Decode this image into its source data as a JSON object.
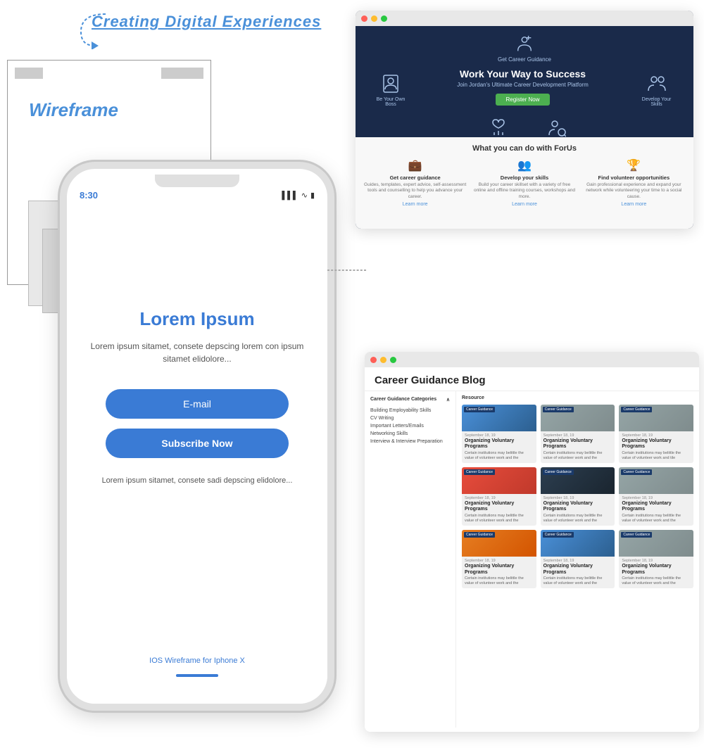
{
  "page": {
    "heading": "Creating Digital Experiences"
  },
  "wireframe": {
    "label": "Wireframe"
  },
  "iphone": {
    "status_time": "8:30",
    "lorem_title": "Lorem Ipsum",
    "lorem_desc": "Lorem ipsum sitamet, consete depscing lorem con ipsum sitamet elidolore...",
    "email_placeholder": "E-mail",
    "subscribe_btn": "Subscribe Now",
    "lorem_sub": "Lorem ipsum sitamet, consete sadi depscing elidolore...",
    "bottom_label": "IOS Wireframe for Iphone X"
  },
  "browser1": {
    "nav": {
      "item1": "Get Career Guidance"
    },
    "hero": {
      "left_icon": "Be Your Own Boss",
      "right_icon": "Develop Your Skills",
      "title": "Work Your Way to Success",
      "subtitle": "Join Jordan's Ultimate Career Development Platform",
      "register_btn": "Register Now",
      "bottom_left": "Find Volunteer Opportunities",
      "bottom_right": "Search for Jobs"
    },
    "what_section": {
      "title": "What you can do with ForUs",
      "item1_title": "Get career guidance",
      "item1_desc": "Guides, templates, expert advice, self-assessment tools and counselling to help you advance your career.",
      "item1_link": "Learn more",
      "item2_title": "Develop your skills",
      "item2_desc": "Build your career skillset with a variety of free online and offline training courses, workshops and more.",
      "item2_link": "Learn more",
      "item3_title": "Find volunteer opportunities",
      "item3_desc": "Gain professional experience and expand your network while volunteering your time to a social cause.",
      "item3_link": "Learn more"
    }
  },
  "browser2": {
    "title": "Career Guidance Blog",
    "sidebar_header": "Career Guidance Categories",
    "categories": [
      "Building Employability Skills",
      "CV Writing",
      "Important Letters/Emails",
      "Networking Skills",
      "Interview & Interview Preparation"
    ],
    "resource_label": "Resource",
    "cards": [
      {
        "badge": "Career Guidance",
        "date": "September 18, 19",
        "title": "Organizing Voluntary Programs",
        "desc": "Certain institutions may belittle the value of volunteer work and the",
        "img_class": "img-blue"
      },
      {
        "badge": "Career Guidance",
        "date": "September 18, 19",
        "title": "Organizing Voluntary Programs",
        "desc": "Certain institutions may belittle the value of volunteer work and the",
        "img_class": "img-gray"
      },
      {
        "badge": "Career Guidance",
        "date": "September 18, 19",
        "title": "Organizing Voluntary Programs",
        "desc": "Certain institutions may belittle the value of volunteer work and tile",
        "img_class": "img-gray"
      },
      {
        "badge": "Career Guidance",
        "date": "September 18, 19",
        "title": "Organizing Voluntary Programs",
        "desc": "Certain institutions may belittle the value of volunteer work and the",
        "img_class": "img-red"
      },
      {
        "badge": "Career Guidance",
        "date": "September 18, 19",
        "title": "Organizing Voluntary Programs",
        "desc": "Certain institutions may belittle the value of volunteer work and the",
        "img_class": "img-dark"
      },
      {
        "badge": "Career Guidance",
        "date": "September 18, 19",
        "title": "Organizing Voluntary Programs",
        "desc": "Certain institutions may belittle the value of volunteer work and the",
        "img_class": "img-gray"
      },
      {
        "badge": "Career Guidance",
        "date": "September 18, 19",
        "title": "Organizing Voluntary Programs",
        "desc": "Certain institutions may belittle the value of volunteer work and the",
        "img_class": "img-orange"
      },
      {
        "badge": "Career Guidance",
        "date": "September 18, 19",
        "title": "Organizing Voluntary Programs",
        "desc": "Certain institutions may belittle the value of volunteer work and the",
        "img_class": "img-blue"
      },
      {
        "badge": "Career Guidance",
        "date": "September 18, 19",
        "title": "Organizing Voluntary Programs",
        "desc": "Certain institutions may belittle the value of volunteer work and the",
        "img_class": "img-gray"
      }
    ]
  },
  "colors": {
    "blue": "#3a7bd5",
    "dark_navy": "#1a2a4a",
    "green": "#4caf50",
    "gray": "#cccccc"
  }
}
